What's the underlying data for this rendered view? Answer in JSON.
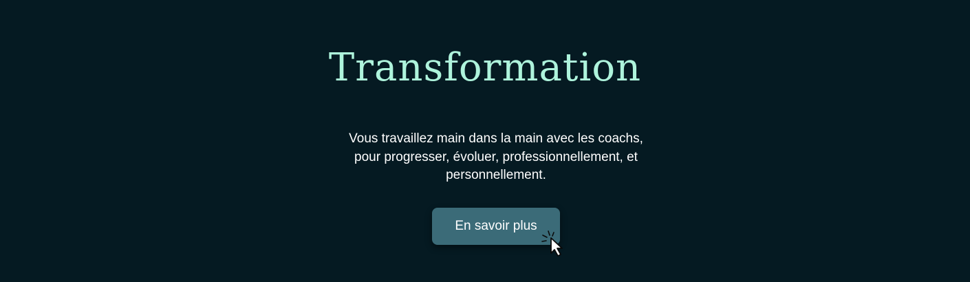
{
  "hero": {
    "title": "Transformation",
    "description": "Vous travaillez main dans la main avec les coachs, pour progresser, évoluer, professionnellement, et personnellement.",
    "cta_label": "En savoir plus"
  },
  "colors": {
    "background": "#051a22",
    "title": "#aef4dc",
    "text": "#ffffff",
    "button": "#3b6b78"
  },
  "icons": {
    "pointer": "click-cursor-icon"
  }
}
